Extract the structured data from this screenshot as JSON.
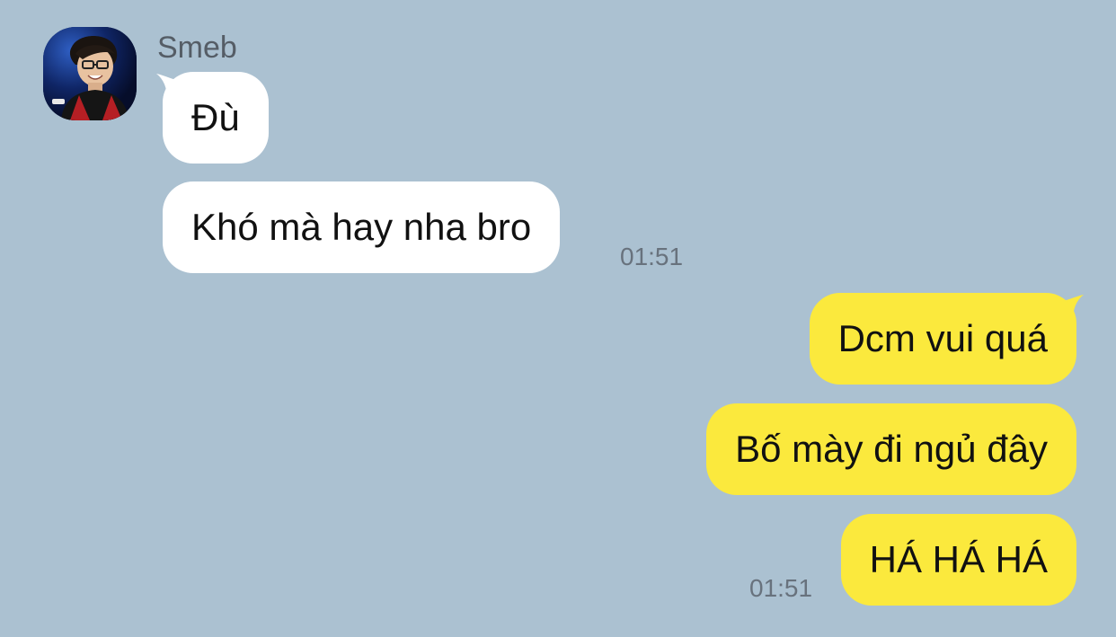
{
  "chat": {
    "colors": {
      "background": "#abc1d1",
      "incoming_bubble": "#ffffff",
      "outgoing_bubble": "#fbe93d",
      "timestamp": "#68727d",
      "sender_name": "#555d66"
    },
    "sender": {
      "name": "Smeb",
      "avatar_icon": "profile-photo"
    },
    "incoming": [
      {
        "text": "Đù"
      },
      {
        "text": "Khó mà hay nha bro",
        "time": "01:51"
      }
    ],
    "outgoing": [
      {
        "text": "Dcm vui quá"
      },
      {
        "text": "Bố mày đi ngủ đây"
      },
      {
        "text": "HÁ HÁ HÁ",
        "time": "01:51"
      }
    ]
  }
}
